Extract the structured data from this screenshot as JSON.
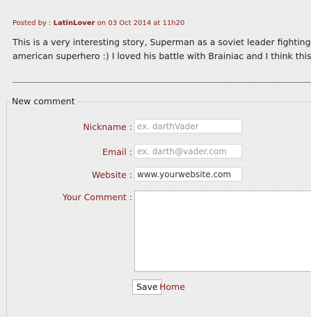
{
  "comment": {
    "posted_prefix": "Posted by :",
    "author": "LatinLover",
    "posted_suffix": "on 03 Oct 2014 at 11h20",
    "text_line1": "This is a very interesting story, Superman as a soviet leader fighting for comm",
    "text_line2": "american superhero :) I loved his battle with Brainiac and I think this graphic nc"
  },
  "form": {
    "legend": "New comment",
    "nickname_label": "Nickname :",
    "nickname_placeholder": "ex. darthVader",
    "email_label": "Email :",
    "email_placeholder": "ex. darth@vader.com",
    "website_label": "Website :",
    "website_value": "www.yourwebsite.com",
    "comment_label": "Your Comment :",
    "comment_value": "",
    "save_label": "Save",
    "home_label": "Home"
  }
}
